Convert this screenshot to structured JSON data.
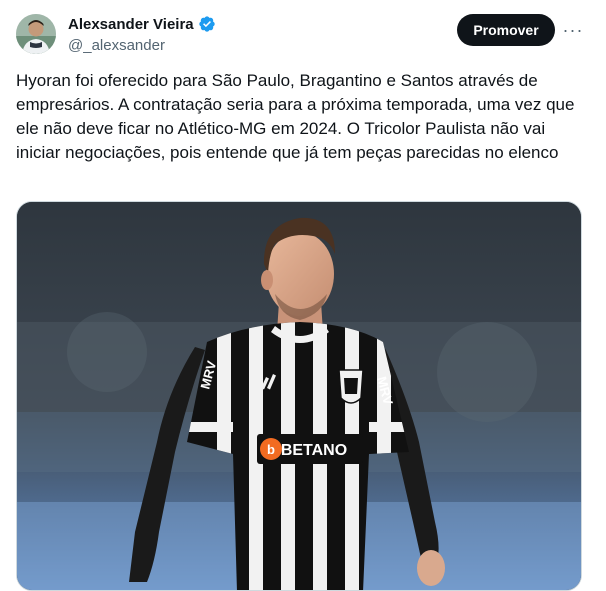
{
  "author": {
    "display_name": "Alexsander Vieira",
    "handle": "@_alexsander",
    "verified": true,
    "verified_icon": "verified-badge-icon",
    "verified_color": "#1d9bf0",
    "avatar_icon": "avatar-photo"
  },
  "actions": {
    "promote_label": "Promover",
    "more_icon": "more-options-icon",
    "more_glyph": "···"
  },
  "tweet": {
    "text": "Hyoran foi oferecido para São Paulo, Bragantino e Santos através de empresários. A contratação seria para a próxima temporada, uma vez que ele não deve ficar no Atlético-MG em 2024. O Tricolor Paulista não vai iniciar negociações, pois entende que já tem peças parecidas no elenco"
  },
  "media": {
    "jersey_sponsor": "BETANO",
    "jersey_side_sponsor": "MRV",
    "jersey_stripe_colors": [
      "#111111",
      "#f2f2f2"
    ],
    "background_colors": [
      "#3b4550",
      "#5a7fae"
    ]
  },
  "colors": {
    "text_primary": "#0f1419",
    "text_secondary": "#536471",
    "button_bg": "#0f1419",
    "button_text": "#ffffff",
    "accent": "#1d9bf0",
    "sponsor_orange": "#f26b21"
  }
}
